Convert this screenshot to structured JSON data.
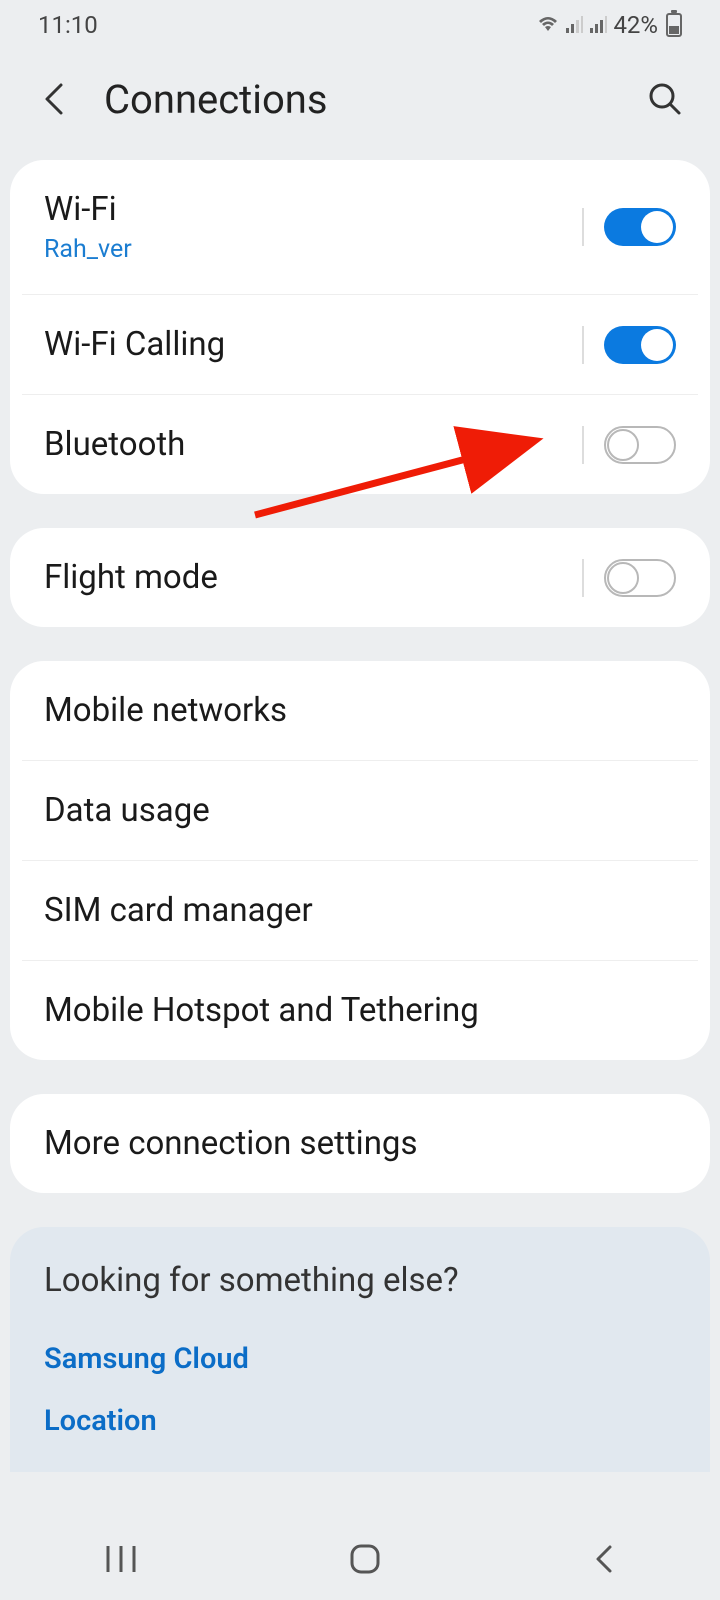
{
  "status": {
    "time": "11:10",
    "battery": "42%"
  },
  "header": {
    "title": "Connections"
  },
  "group1": {
    "wifi": {
      "title": "Wi-Fi",
      "network": "Rah_ver",
      "on": true
    },
    "wificalling": {
      "title": "Wi-Fi Calling",
      "on": true
    },
    "bluetooth": {
      "title": "Bluetooth",
      "on": false
    }
  },
  "group2": {
    "flight": {
      "title": "Flight mode",
      "on": false
    }
  },
  "group3": {
    "mobile": "Mobile networks",
    "data": "Data usage",
    "sim": "SIM card manager",
    "hotspot": "Mobile Hotspot and Tethering"
  },
  "group4": {
    "more": "More connection settings"
  },
  "suggest": {
    "title": "Looking for something else?",
    "link1": "Samsung Cloud",
    "link2": "Location"
  }
}
